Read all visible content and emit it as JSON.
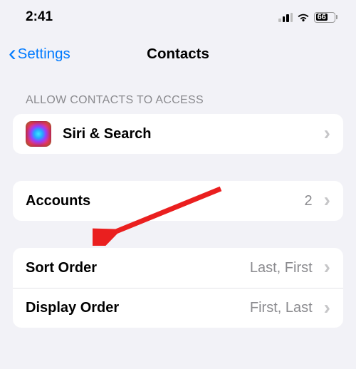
{
  "status": {
    "time": "2:41",
    "battery_pct": "66"
  },
  "nav": {
    "back_label": "Settings",
    "title": "Contacts"
  },
  "section_header": "ALLOW CONTACTS TO ACCESS",
  "rows": {
    "siri_label": "Siri & Search",
    "accounts_label": "Accounts",
    "accounts_value": "2",
    "sort_label": "Sort Order",
    "sort_value": "Last, First",
    "display_label": "Display Order",
    "display_value": "First, Last"
  }
}
